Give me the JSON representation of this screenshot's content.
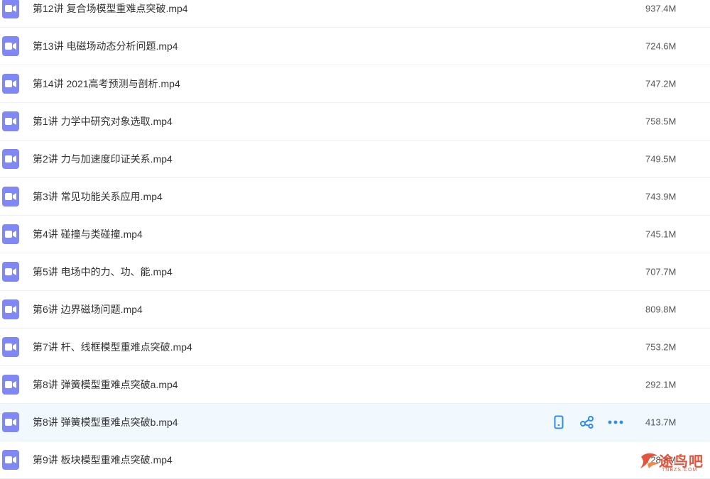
{
  "files": [
    {
      "name": "第12讲 复合场模型重难点突破.mp4",
      "size": "937.4M"
    },
    {
      "name": "第13讲 电磁场动态分析问题.mp4",
      "size": "724.6M"
    },
    {
      "name": "第14讲 2021高考预测与剖析.mp4",
      "size": "747.2M"
    },
    {
      "name": "第1讲 力学中研究对象选取.mp4",
      "size": "758.5M"
    },
    {
      "name": "第2讲 力与加速度印证关系.mp4",
      "size": "749.5M"
    },
    {
      "name": "第3讲 常见功能关系应用.mp4",
      "size": "743.9M"
    },
    {
      "name": "第4讲 碰撞与类碰撞.mp4",
      "size": "745.1M"
    },
    {
      "name": "第5讲 电场中的力、功、能.mp4",
      "size": "707.7M"
    },
    {
      "name": "第6讲 边界磁场问题.mp4",
      "size": "809.8M"
    },
    {
      "name": "第7讲 杆、线框模型重难点突破.mp4",
      "size": "753.2M"
    },
    {
      "name": "第8讲 弹簧模型重难点突破a.mp4",
      "size": "292.1M"
    },
    {
      "name": "第8讲 弹簧模型重难点突破b.mp4",
      "size": "413.7M"
    },
    {
      "name": "第9讲 板块模型重难点突破.mp4",
      "size": "728.8M"
    }
  ],
  "hover_row_index": 11,
  "icons": {
    "file": "video-file-icon",
    "actions": [
      "phone-icon",
      "share-icon",
      "more-icon"
    ]
  },
  "watermark": {
    "text": "途鸟吧",
    "sub": "TNBZS.COM"
  },
  "colors": {
    "icon": "#7f88f5",
    "action": "#2f8cf0",
    "hover_bg": "#f1f8fe",
    "watermark": "#e2543c"
  }
}
